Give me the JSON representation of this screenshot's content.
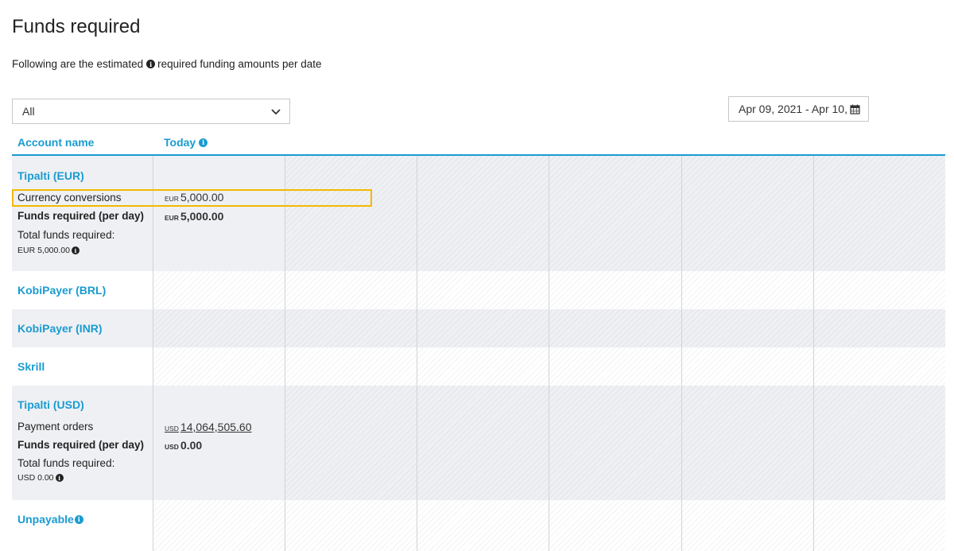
{
  "page": {
    "title": "Funds required",
    "subtitle_before": "Following are the estimated",
    "subtitle_after": "required funding amounts per date"
  },
  "filter": {
    "selected": "All"
  },
  "date_range": {
    "value": "Apr 09, 2021 - Apr 10,"
  },
  "table": {
    "headers": {
      "account": "Account name",
      "today": "Today"
    },
    "accounts": [
      {
        "name": "Tipalti (EUR)",
        "detail_label": "Currency conversions",
        "detail_currency": "EUR",
        "detail_value": "5,000.00",
        "per_day_label": "Funds required (per day)",
        "per_day_currency": "EUR",
        "per_day_value": "5,000.00",
        "total_label": "Total funds required:",
        "total_value": "EUR 5,000.00"
      },
      {
        "name": "KobiPayer (BRL)"
      },
      {
        "name": "KobiPayer (INR)"
      },
      {
        "name": "Skrill"
      },
      {
        "name": "Tipalti (USD)",
        "detail_label": "Payment orders",
        "detail_currency": "USD",
        "detail_value": "14,064,505.60",
        "per_day_label": "Funds required (per day)",
        "per_day_currency": "USD",
        "per_day_value": "0.00",
        "total_label": "Total funds required:",
        "total_value": "USD 0.00"
      },
      {
        "name": "Unpayable"
      }
    ]
  },
  "colors": {
    "accent": "#1a9bd1",
    "highlight": "#f5b800",
    "row_grey": "#eef0f3"
  }
}
